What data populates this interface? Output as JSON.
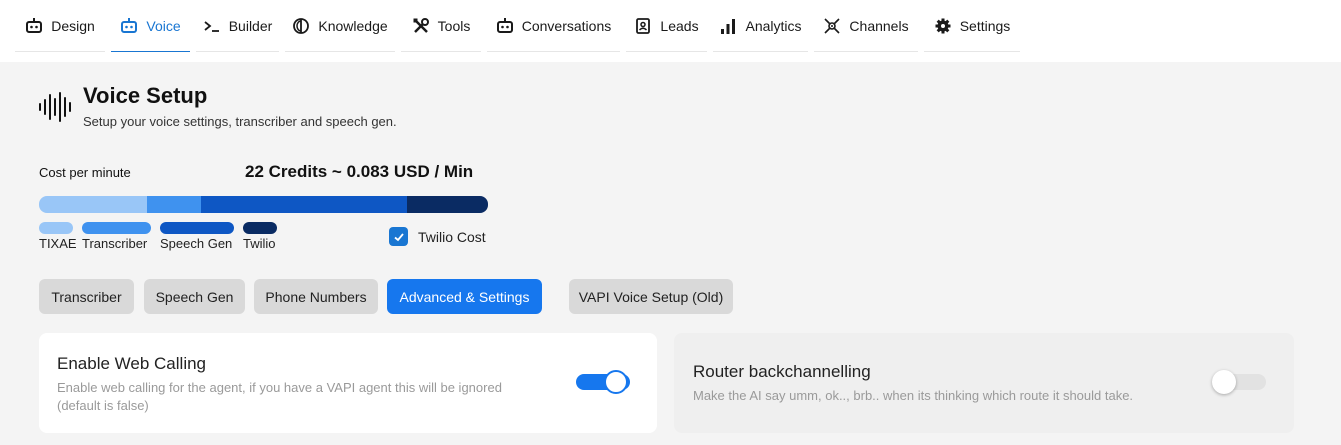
{
  "nav": {
    "tabs": [
      {
        "label": "Design",
        "icon": "robot-icon"
      },
      {
        "label": "Voice",
        "icon": "robot-icon",
        "active": true
      },
      {
        "label": "Builder",
        "icon": "terminal-icon"
      },
      {
        "label": "Knowledge",
        "icon": "knowledge-icon"
      },
      {
        "label": "Tools",
        "icon": "tools-icon"
      },
      {
        "label": "Conversations",
        "icon": "robot-icon"
      },
      {
        "label": "Leads",
        "icon": "lead-badge-icon"
      },
      {
        "label": "Analytics",
        "icon": "bar-chart-icon"
      },
      {
        "label": "Channels",
        "icon": "satellite-icon"
      },
      {
        "label": "Settings",
        "icon": "gear-icon"
      }
    ]
  },
  "header": {
    "title": "Voice Setup",
    "subtitle": "Setup your voice settings, transcriber and speech gen."
  },
  "cost": {
    "label": "Cost per minute",
    "value": "22 Credits ~ 0.083 USD / Min",
    "segments": [
      {
        "name": "TIXAE",
        "color": "#99c6f7",
        "fraction": 0.241
      },
      {
        "name": "Transcriber",
        "color": "#3f92ef",
        "fraction": 0.12
      },
      {
        "name": "Speech Gen",
        "color": "#0e57c4",
        "fraction": 0.459
      },
      {
        "name": "Twilio",
        "color": "#0a2b63",
        "fraction": 0.18
      }
    ],
    "twilio_cost_label": "Twilio Cost",
    "twilio_cost_checked": true
  },
  "tabs": [
    {
      "label": "Transcriber",
      "active": false
    },
    {
      "label": "Speech Gen",
      "active": false
    },
    {
      "label": "Phone Numbers",
      "active": false
    },
    {
      "label": "Advanced & Settings",
      "active": true
    },
    {
      "label": "VAPI Voice Setup (Old)",
      "active": false
    }
  ],
  "settings": {
    "web_calling": {
      "title": "Enable Web Calling",
      "description": "Enable web calling for the agent, if you have a VAPI agent this will be ignored (default is false)",
      "enabled": true
    },
    "router_backchannelling": {
      "title": "Router backchannelling",
      "description": "Make the AI say umm, ok.., brb.. when its thinking which route it should take.",
      "enabled": false
    }
  },
  "colors": {
    "accent": "#1976d2",
    "active_tab": "#1677ee"
  }
}
